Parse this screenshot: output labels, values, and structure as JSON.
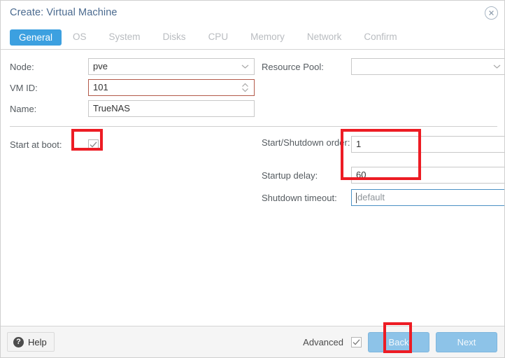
{
  "window": {
    "title": "Create: Virtual Machine",
    "close_icon": "close-circle-icon"
  },
  "tabs": [
    {
      "label": "General",
      "active": true
    },
    {
      "label": "OS",
      "active": false
    },
    {
      "label": "System",
      "active": false
    },
    {
      "label": "Disks",
      "active": false
    },
    {
      "label": "CPU",
      "active": false
    },
    {
      "label": "Memory",
      "active": false
    },
    {
      "label": "Network",
      "active": false
    },
    {
      "label": "Confirm",
      "active": false
    }
  ],
  "form": {
    "left": {
      "node_label": "Node:",
      "node_value": "pve",
      "vmid_label": "VM ID:",
      "vmid_value": "101",
      "name_label": "Name:",
      "name_value": "TrueNAS",
      "start_at_boot_label": "Start at boot:",
      "start_at_boot_checked": "checked"
    },
    "right": {
      "resource_pool_label": "Resource Pool:",
      "resource_pool_value": "",
      "order_label": "Start/Shutdown order:",
      "order_value": "1",
      "delay_label": "Startup delay:",
      "delay_value": "60",
      "timeout_label": "Shutdown timeout:",
      "timeout_value": "",
      "timeout_placeholder": "default"
    }
  },
  "footer": {
    "help_label": "Help",
    "help_icon": "question-mark-icon",
    "advanced_label": "Advanced",
    "advanced_checked": "checked",
    "back_label": "Back",
    "next_label": "Next"
  },
  "colors": {
    "accent": "#3ca0e0",
    "title": "#4a6a8f",
    "annotation": "#ed1c24",
    "invalid_border": "#b35a4a",
    "focus_border": "#4a90c4",
    "button": "#8dc3e8"
  }
}
